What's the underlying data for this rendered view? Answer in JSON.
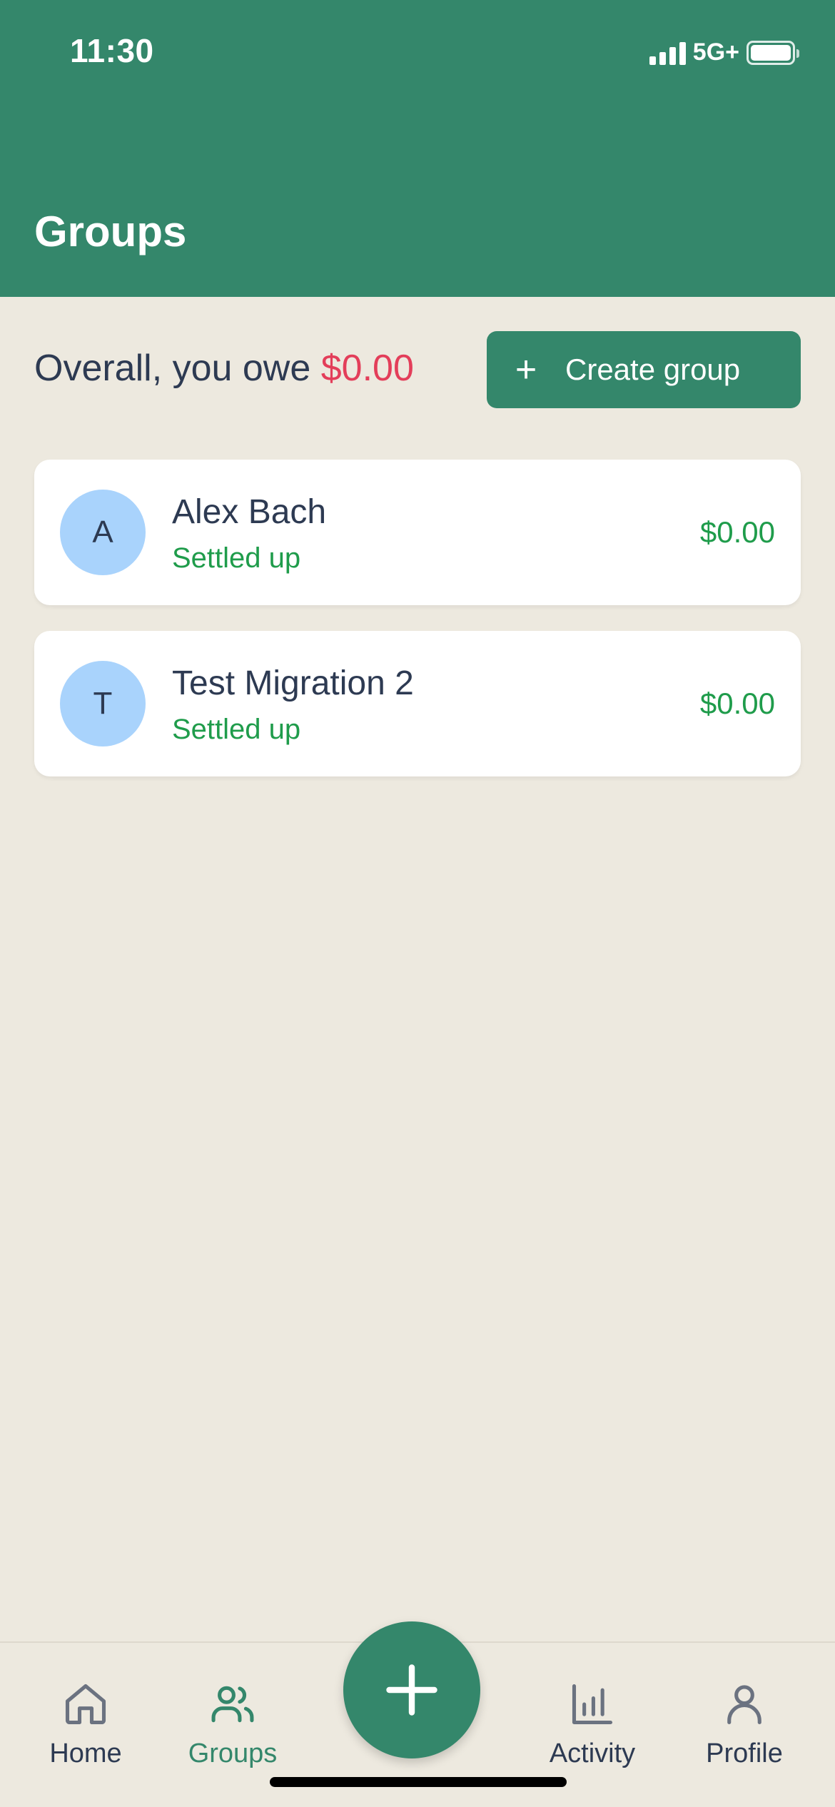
{
  "status_bar": {
    "time": "11:30",
    "network": "5G+"
  },
  "header": {
    "title": "Groups"
  },
  "summary": {
    "prefix": "Overall, you owe ",
    "amount": "$0.00"
  },
  "create_button": {
    "icon": "plus-icon",
    "label": "Create group"
  },
  "groups": [
    {
      "initial": "A",
      "name": "Alex Bach",
      "status": "Settled up",
      "amount": "$0.00"
    },
    {
      "initial": "T",
      "name": "Test Migration 2",
      "status": "Settled up",
      "amount": "$0.00"
    }
  ],
  "nav": {
    "home": {
      "label": "Home",
      "icon": "home-icon"
    },
    "groups": {
      "label": "Groups",
      "icon": "users-icon"
    },
    "add": {
      "icon": "plus-icon"
    },
    "activity": {
      "label": "Activity",
      "icon": "bar-chart-icon"
    },
    "profile": {
      "label": "Profile",
      "icon": "user-icon"
    }
  },
  "colors": {
    "brand": "#34876b",
    "background": "#ede9df",
    "owe": "#e33e5a",
    "settled": "#1f9c4b",
    "avatar": "#a9d3fc",
    "text": "#2d3a52"
  }
}
